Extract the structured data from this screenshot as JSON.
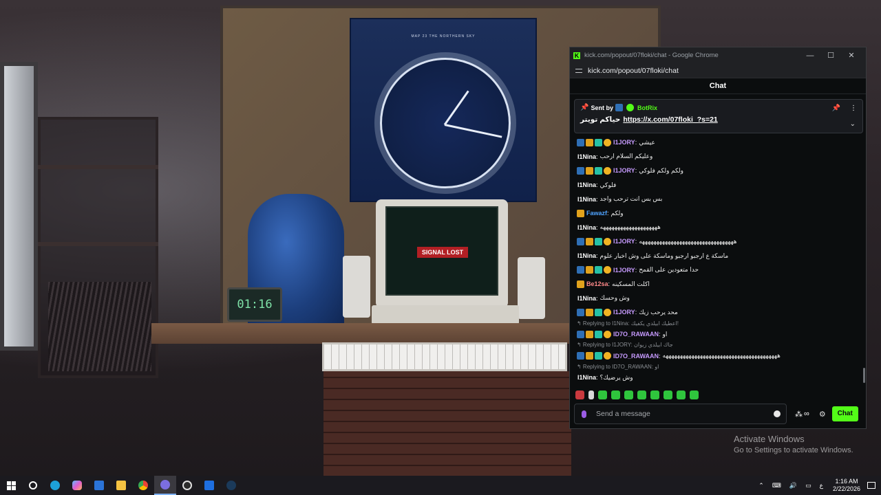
{
  "wallpaper": {
    "poster_title": "MAP 23\nTHE NORTHERN SKY",
    "monitor_banner": "SIGNAL LOST",
    "desk_clock": "01:16"
  },
  "browser": {
    "title": "kick.com/popout/07floki/chat - Google Chrome",
    "url": "kick.com/popout/07floki/chat",
    "minimize_glyph": "—",
    "maximize_glyph": "☐",
    "close_glyph": "✕"
  },
  "chat": {
    "header": "Chat",
    "pinned": {
      "sent_by_label": "Sent by",
      "sender": "BotRix",
      "text": "حياكم تويتر",
      "link": "https://x.com/07floki_?s=21"
    },
    "messages": [
      {
        "type": "msg",
        "badges": [
          "blue",
          "gold",
          "teal",
          "coin"
        ],
        "user": "I1JORY",
        "color": "#c79bff",
        "text": "عيشي"
      },
      {
        "type": "msg",
        "badges": [],
        "user": "I1Nina",
        "color": "#ffffff",
        "text": "وعليكم السلام ارحب"
      },
      {
        "type": "msg",
        "badges": [
          "blue",
          "gold",
          "teal",
          "coin"
        ],
        "user": "I1JORY",
        "color": "#c79bff",
        "text": "ولكم ولكم فلوكي"
      },
      {
        "type": "msg",
        "badges": [],
        "user": "I1Nina",
        "color": "#ffffff",
        "text": "فلوكي"
      },
      {
        "type": "msg",
        "badges": [],
        "user": "I1Nina",
        "color": "#ffffff",
        "text": "بس بس انت ترحب واجد"
      },
      {
        "type": "msg",
        "badges": [
          "gold"
        ],
        "user": "Fawazf",
        "color": "#4fa3ff",
        "text": "ولكم"
      },
      {
        "type": "msg",
        "badges": [],
        "user": "I1Nina",
        "color": "#ffffff",
        "text": "ههههههههههههههههههههه"
      },
      {
        "type": "msg",
        "badges": [
          "blue",
          "gold",
          "teal",
          "coin"
        ],
        "user": "I1JORY",
        "color": "#c79bff",
        "text": "هههههههههههههههههههههههههههههههههه"
      },
      {
        "type": "msg",
        "badges": [],
        "user": "I1Nina",
        "color": "#ffffff",
        "text": "ماسكة ع ارجبو ارجبو وماسكة على وش اخبار علوم"
      },
      {
        "type": "msg",
        "badges": [
          "blue",
          "gold",
          "teal",
          "coin"
        ],
        "user": "I1JORY",
        "color": "#c79bff",
        "text": "حدا متعودين على القمح"
      },
      {
        "type": "msg",
        "badges": [
          "gold"
        ],
        "user": "Be12sa",
        "color": "#ff8a8a",
        "text": "اكلت المسكينه"
      },
      {
        "type": "msg",
        "badges": [],
        "user": "I1Nina",
        "color": "#ffffff",
        "text": "وش وحسك"
      },
      {
        "type": "msg",
        "badges": [
          "blue",
          "gold",
          "teal",
          "coin"
        ],
        "user": "I1JORY",
        "color": "#c79bff",
        "text": "محد يرحب زيك"
      },
      {
        "type": "reply",
        "text": "↰ Replying to I1Nina: اعطيك ابيلدي يكفيك!"
      },
      {
        "type": "msg",
        "badges": [
          "blue",
          "gold",
          "teal",
          "coin"
        ],
        "user": "ID7O_RAWAAN",
        "color": "#c79bff",
        "text": "او"
      },
      {
        "type": "reply",
        "text": "↰ Replying to I1JORY: جاك ابيلدي زيوان"
      },
      {
        "type": "msg",
        "badges": [
          "blue",
          "gold",
          "teal",
          "coin"
        ],
        "user": "ID7O_RAWAAN",
        "color": "#c79bff",
        "text": "ههههههههههههههههههههههههههههههههههههههههه"
      },
      {
        "type": "reply",
        "text": "↰ Replying to ID7O_RAWAAN: او"
      },
      {
        "type": "msg",
        "badges": [],
        "user": "I1Nina",
        "color": "#ffffff",
        "text": "وش يرضيك؟"
      }
    ],
    "input_placeholder": "Send a message",
    "send_label": "Chat",
    "points_label": "∞"
  },
  "watermark": {
    "line1": "Activate Windows",
    "line2": "Go to Settings to activate Windows."
  },
  "taskbar": {
    "apps": [
      "start-icon",
      "search-icon",
      "edge-icon",
      "copilot-icon",
      "store-icon",
      "file-explorer-icon",
      "chrome-icon",
      "discord-icon",
      "obs-icon",
      "app-icon",
      "steam-icon"
    ],
    "tray": {
      "lang": "ع",
      "time": "1:16 AM",
      "date": "2/22/2026"
    }
  },
  "colors": {
    "kick_green": "#53fc18",
    "chat_bg": "#0b0d0e"
  }
}
